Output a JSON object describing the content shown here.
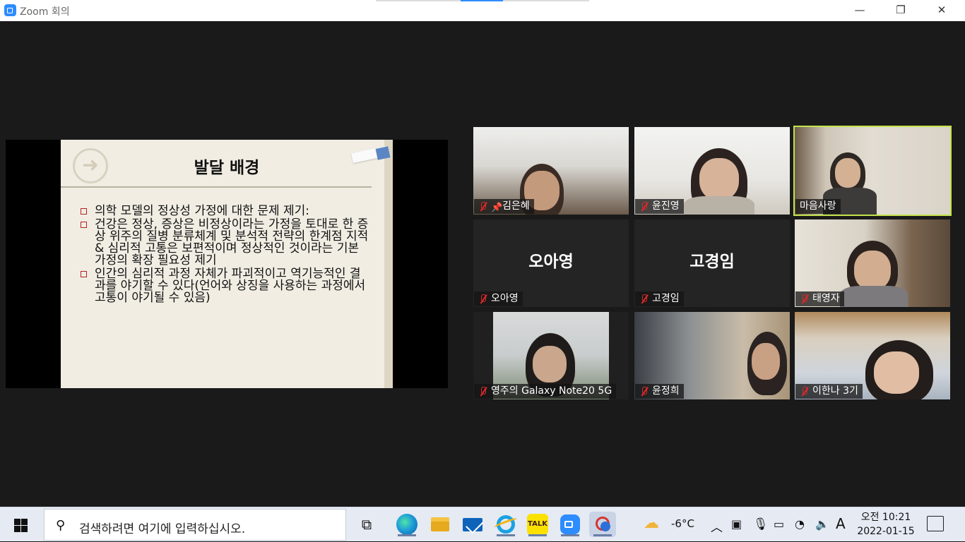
{
  "window": {
    "title": "Zoom 회의",
    "minimize": "—",
    "maximize": "❐",
    "close": "✕"
  },
  "slide": {
    "title": "발달 배경",
    "bullets": [
      "의학 모델의 정상성 가정에 대한 문제 제기:",
      "건강은 정상, 증상은 비정상이라는 가정을 토대로 한 증상 위주의 질병 분류체계 및 분석적 전략의 한계점 지적 & 심리적 고통은 보편적이며 정상적인 것이라는 기본 가정의 확장 필요성 제기",
      "인간의 심리적 과정 자체가 파괴적이고 역기능적인 결과를 야기할 수 있다(언어와 상징을 사용하는 과정에서 고통이 야기될 수 있음)"
    ]
  },
  "participants": [
    {
      "name": "김은혜",
      "video": true,
      "pinned": true
    },
    {
      "name": "윤진영",
      "video": true
    },
    {
      "name": "마음사랑",
      "video": true,
      "speaking": true
    },
    {
      "name": "오아영",
      "video": false
    },
    {
      "name": "고경임",
      "video": false
    },
    {
      "name": "태영자",
      "video": true
    },
    {
      "name": "영주의 Galaxy Note20 5G",
      "video": true
    },
    {
      "name": "윤정희",
      "video": true
    },
    {
      "name": "이한나 3기",
      "video": true
    }
  ],
  "taskbar": {
    "search_placeholder": "검색하려면 여기에 입력하십시오.",
    "weather": "-6°C",
    "input_lang": "A",
    "time": "오전 10:21",
    "date": "2022-01-15",
    "kakao_label": "TALK"
  },
  "colors": {
    "accent": "#2d8cff",
    "speaker_outline": "#c3e34a",
    "mute_red": "#e02828",
    "bullet_red": "#b22222"
  }
}
